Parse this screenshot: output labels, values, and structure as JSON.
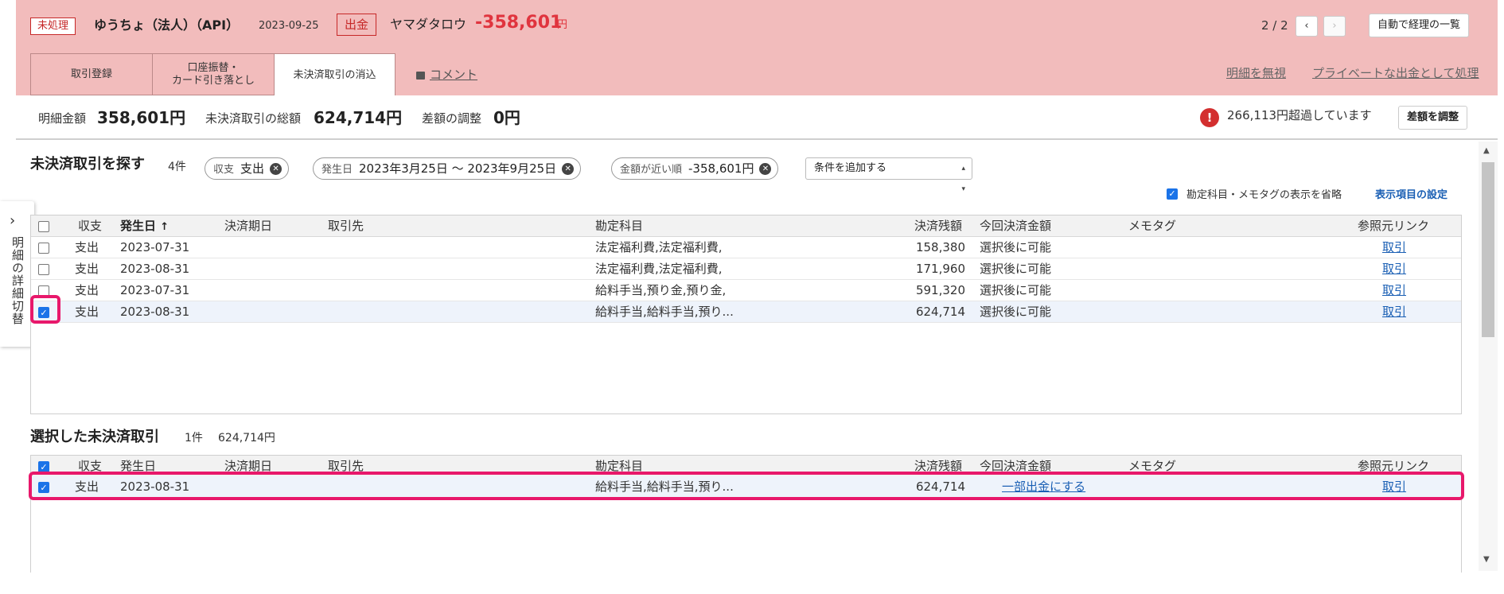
{
  "header": {
    "status_badge": "未処理",
    "account_name": "ゆうちょ（法人）（API）",
    "date": "2023-09-25",
    "type_badge": "出金",
    "payee": "ヤマダタロウ",
    "amount": "-358,601",
    "amount_unit": "円",
    "pager_text": "2 / 2",
    "prev_icon": "chevron-left",
    "next_icon": "chevron-right",
    "auto_list_button": "自動で経理の一覧"
  },
  "tabs": [
    {
      "label": "取引登録",
      "active": false
    },
    {
      "label": "口座振替・\nカード引き落とし",
      "active": false
    },
    {
      "label": "未決済取引の消込",
      "active": true
    }
  ],
  "comment_link": "コメント",
  "ignore_link": "明細を無視",
  "private_link": "プライベートな出金として処理",
  "summary": {
    "detail_amount_label": "明細金額",
    "detail_amount_value": "358,601円",
    "unsettled_total_label": "未決済取引の総額",
    "unsettled_total_value": "624,714円",
    "adjust_label": "差額の調整",
    "adjust_value": "0円",
    "over_text": "266,113円超過しています",
    "adjust_button": "差額を調整",
    "alert_color": "#d32f2f"
  },
  "side_toggle": "明細の詳細切替",
  "search": {
    "title": "未決済取引を探す",
    "count": "4件",
    "chips": [
      {
        "key": "収支",
        "value": "支出"
      },
      {
        "key": "発生日",
        "value": "2023年3月25日 〜 2023年9月25日"
      },
      {
        "key": "金額が近い順",
        "value": "-358,601円"
      }
    ],
    "add_condition": "条件を追加する",
    "option_label": "勘定科目・メモタグの表示を省略",
    "settings_link": "表示項目の設定"
  },
  "columns": [
    "収支",
    "発生日",
    "決済期日",
    "取引先",
    "勘定科目",
    "決済残額",
    "今回決済金額",
    "メモタグ",
    "参照元リンク"
  ],
  "rows": [
    {
      "checked": false,
      "type": "支出",
      "date": "2023-07-31",
      "due": "",
      "partner": "",
      "account": "法定福利費,法定福利費,",
      "balance": "158,380",
      "amount": "選択後に可能",
      "memo": "",
      "link": "取引"
    },
    {
      "checked": false,
      "type": "支出",
      "date": "2023-08-31",
      "due": "",
      "partner": "",
      "account": "法定福利費,法定福利費,",
      "balance": "171,960",
      "amount": "選択後に可能",
      "memo": "",
      "link": "取引"
    },
    {
      "checked": false,
      "type": "支出",
      "date": "2023-07-31",
      "due": "",
      "partner": "",
      "account": "給料手当,預り金,預り金,",
      "balance": "591,320",
      "amount": "選択後に可能",
      "memo": "",
      "link": "取引"
    },
    {
      "checked": true,
      "type": "支出",
      "date": "2023-08-31",
      "due": "",
      "partner": "",
      "account": "給料手当,給料手当,預り...",
      "balance": "624,714",
      "amount": "選択後に可能",
      "memo": "",
      "link": "取引"
    }
  ],
  "selected": {
    "title": "選択した未決済取引",
    "count": "1件",
    "total": "624,714円",
    "rows": [
      {
        "checked": true,
        "type": "支出",
        "date": "2023-08-31",
        "due": "",
        "partner": "",
        "account": "給料手当,給料手当,預り...",
        "balance": "624,714",
        "amount": "一部出金にする",
        "memo": "",
        "link": "取引"
      }
    ]
  },
  "colors": {
    "header_bg": "#f2bcbc",
    "accent_red": "#e0343e",
    "link_blue": "#1a5fb4",
    "highlight": "#e8186b"
  }
}
